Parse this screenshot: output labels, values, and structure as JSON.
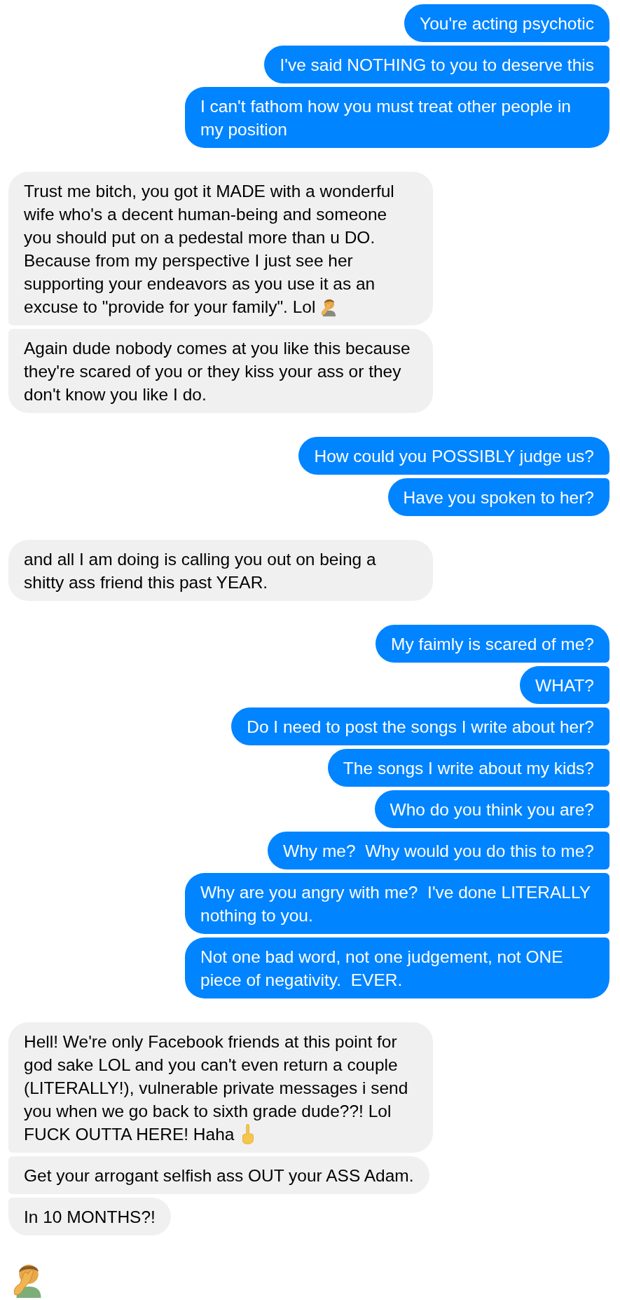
{
  "groups": [
    {
      "outgoing": true,
      "messages": [
        {
          "kind": "text",
          "parts": [
            {
              "kind": "text",
              "text": "You're acting psychotic"
            }
          ]
        },
        {
          "kind": "text",
          "parts": [
            {
              "kind": "text",
              "text": "I've said NOTHING to you to deserve this"
            }
          ]
        },
        {
          "kind": "text",
          "parts": [
            {
              "kind": "text",
              "text": "I can't fathom how you must treat other people in my position"
            }
          ]
        }
      ]
    },
    {
      "outgoing": false,
      "messages": [
        {
          "kind": "text",
          "parts": [
            {
              "kind": "text",
              "text": "Trust me bitch, you got it MADE with a wonderful wife who's a decent human-being and someone you should put on a pedestal more than u DO. Because from my perspective I just see her supporting your endeavors as you use it as an excuse to \"provide for your family\". Lol"
            },
            {
              "kind": "facepalm"
            }
          ]
        },
        {
          "kind": "text",
          "parts": [
            {
              "kind": "text",
              "text": "Again dude nobody comes at you like this because they're scared of you or they kiss your ass or they don't know you like I do."
            }
          ]
        }
      ]
    },
    {
      "outgoing": true,
      "messages": [
        {
          "kind": "text",
          "parts": [
            {
              "kind": "text",
              "text": "How could you POSSIBLY judge us?"
            }
          ]
        },
        {
          "kind": "text",
          "parts": [
            {
              "kind": "text",
              "text": "Have you spoken to her?"
            }
          ]
        }
      ]
    },
    {
      "outgoing": false,
      "messages": [
        {
          "kind": "text",
          "parts": [
            {
              "kind": "text",
              "text": "and all I am doing is calling you out on being a shitty ass friend this past YEAR."
            }
          ]
        }
      ]
    },
    {
      "outgoing": true,
      "messages": [
        {
          "kind": "text",
          "parts": [
            {
              "kind": "text",
              "text": "My faimly is scared of me?"
            }
          ]
        },
        {
          "kind": "text",
          "parts": [
            {
              "kind": "text",
              "text": "WHAT?"
            }
          ]
        },
        {
          "kind": "text",
          "parts": [
            {
              "kind": "text",
              "text": "Do I need to post the songs I write about her?"
            }
          ]
        },
        {
          "kind": "text",
          "parts": [
            {
              "kind": "text",
              "text": "The songs I write about my kids?"
            }
          ]
        },
        {
          "kind": "text",
          "parts": [
            {
              "kind": "text",
              "text": "Who do you think you are?"
            }
          ]
        },
        {
          "kind": "text",
          "parts": [
            {
              "kind": "text",
              "text": "Why me?  Why would you do this to me?"
            }
          ]
        },
        {
          "kind": "text",
          "parts": [
            {
              "kind": "text",
              "text": "Why are you angry with me?  I've done LITERALLY nothing to you."
            }
          ]
        },
        {
          "kind": "text",
          "parts": [
            {
              "kind": "text",
              "text": "Not one bad word, not one judgement, not ONE piece of negativity.  EVER."
            }
          ]
        }
      ]
    },
    {
      "outgoing": false,
      "messages": [
        {
          "kind": "text",
          "parts": [
            {
              "kind": "text",
              "text": "Hell! We're only Facebook friends at this point for god sake LOL and you can't even return a couple (LITERALLY!), vulnerable private messages i send you when we go back to sixth grade dude??! Lol FUCK OUTTA HERE! Haha"
            },
            {
              "kind": "middle-finger"
            }
          ]
        },
        {
          "kind": "text",
          "parts": [
            {
              "kind": "text",
              "text": "Get your arrogant selfish ass OUT your ASS Adam."
            }
          ]
        },
        {
          "kind": "text",
          "parts": [
            {
              "kind": "text",
              "text": "In 10 MONTHS?!"
            }
          ]
        }
      ]
    },
    {
      "messages": [
        {
          "kind": "facepalm"
        }
      ]
    }
  ]
}
